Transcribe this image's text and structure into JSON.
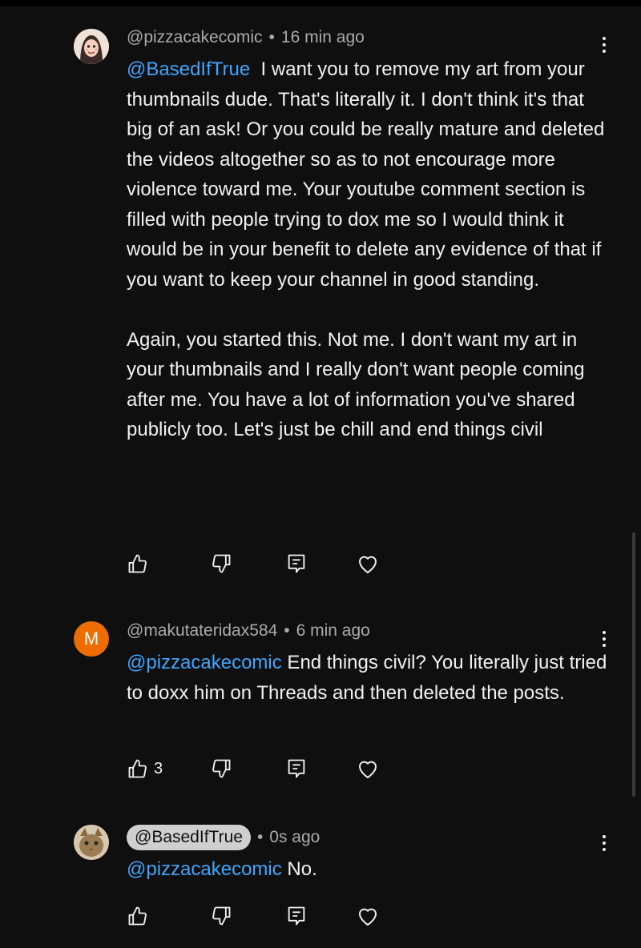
{
  "comments": [
    {
      "author": "@pizzacakecomic",
      "time": "16 min ago",
      "mention": "@BasedIfTrue",
      "text": "  I want you to remove my art from your thumbnails dude. That's literally it. I don't think it's that big of an ask! Or you could be really mature and deleted the videos altogether so as to not encourage more violence toward me. Your youtube comment section is filled with people trying to dox me so I would think it would be in your benefit to delete any evidence of that if you want to keep your channel in good standing.\n\nAgain, you started this. Not me. I don't want my art in your thumbnails and I really don't want people coming after me. You have a lot of information you've shared publicly too. Let's just be chill and end things civil",
      "likes": "",
      "avatar_color": "#d9b8a8"
    },
    {
      "author": "@makutateridax584",
      "time": "6 min ago",
      "mention": "@pizzacakecomic",
      "text": " End things civil? You literally just tried to doxx him on Threads and then deleted the posts.",
      "likes": "3",
      "avatar_letter": "M",
      "avatar_color": "#ef6c00"
    },
    {
      "author": "@BasedIfTrue",
      "time": "0s ago",
      "mention": "@pizzacakecomic",
      "text": " No.",
      "likes": "",
      "avatar_color": "#8a7458"
    }
  ],
  "separator": "•",
  "colors": {
    "background": "#0f0f0f",
    "text": "#f1f1f1",
    "meta": "#aaaaaa",
    "link": "#3ea6ff",
    "chip": "#cfcfcf"
  },
  "icons": [
    "thumbs-up-icon",
    "thumbs-down-icon",
    "reply-icon",
    "heart-icon",
    "more-vert-icon"
  ]
}
